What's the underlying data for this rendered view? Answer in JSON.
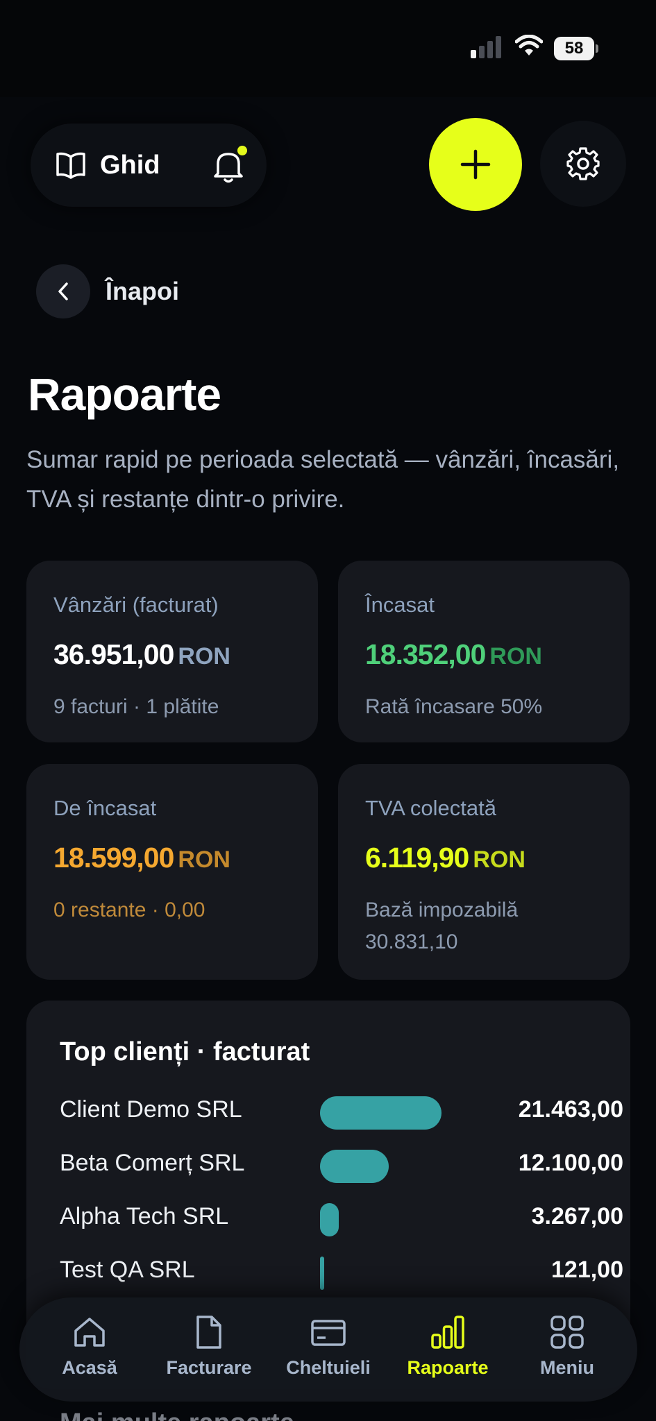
{
  "status_bar": {
    "battery": "58"
  },
  "header": {
    "guide_label": "Ghid",
    "accent_color": "#e6ff1a"
  },
  "back": {
    "label": "Înapoi"
  },
  "page": {
    "title": "Rapoarte",
    "subtitle": "Sumar rapid pe perioada selectată — vânzări, încasări, TVA și restanțe dintr-o privire."
  },
  "stats": [
    {
      "label": "Vânzări (facturat)",
      "value": "36.951,00",
      "currency": "RON",
      "meta": "9 facturi · 1 plătite",
      "value_color": "#ffffff",
      "currency_color": "#8fa4bf",
      "meta_color": "#8d9bb0"
    },
    {
      "label": "Încasat",
      "value": "18.352,00",
      "currency": "RON",
      "meta": "Rată încasare 50%",
      "value_color": "#4fd07a",
      "currency_color": "#2f9a58",
      "meta_color": "#8d9bb0"
    },
    {
      "label": "De încasat",
      "value": "18.599,00",
      "currency": "RON",
      "meta": "0 restante · 0,00",
      "value_color": "#f5a830",
      "currency_color": "#c58a2c",
      "meta_color": "#c08a3a"
    },
    {
      "label": "TVA colectată",
      "value": "6.119,90",
      "currency": "RON",
      "meta": "Bază impozabilă 30.831,10",
      "value_color": "#e6ff1a",
      "currency_color": "#c7dc1c",
      "meta_color": "#8d9bb0"
    }
  ],
  "top_clients": {
    "title": "Top clienți · facturat",
    "bar_color": "#36a2a4",
    "rows": [
      {
        "name": "Client Demo SRL",
        "amount": "21.463,00",
        "value": 21463
      },
      {
        "name": "Beta Comerț SRL",
        "amount": "12.100,00",
        "value": 12100
      },
      {
        "name": "Alpha Tech SRL",
        "amount": "3.267,00",
        "value": 3267
      },
      {
        "name": "Test QA SRL",
        "amount": "121,00",
        "value": 121
      }
    ]
  },
  "more_reports": {
    "title": "Mai multe rapoarte"
  },
  "bottom_nav": {
    "active": "Rapoarte",
    "items": [
      {
        "label": "Acasă",
        "icon": "home-icon"
      },
      {
        "label": "Facturare",
        "icon": "document-icon"
      },
      {
        "label": "Cheltuieli",
        "icon": "card-icon"
      },
      {
        "label": "Rapoarte",
        "icon": "bar-chart-icon"
      },
      {
        "label": "Meniu",
        "icon": "grid-icon"
      }
    ]
  }
}
